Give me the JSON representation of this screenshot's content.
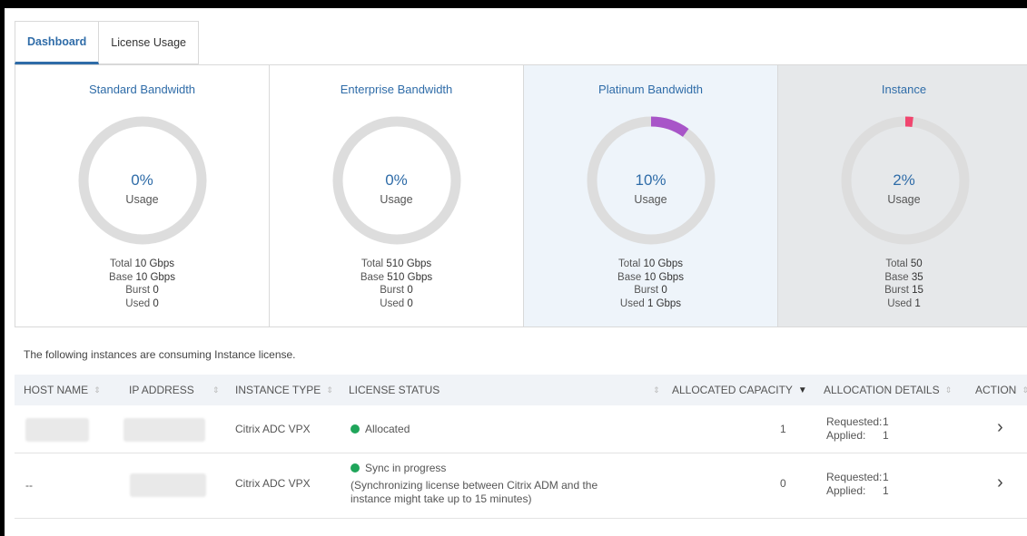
{
  "tabs": [
    {
      "label": "Dashboard",
      "active": true
    },
    {
      "label": "License Usage",
      "active": false
    }
  ],
  "cards": [
    {
      "title": "Standard Bandwidth",
      "percent_label": "0%",
      "usage_label": "Usage",
      "usage_fraction": 0.0,
      "stats": {
        "total_label": "Total",
        "total": "10 Gbps",
        "base_label": "Base",
        "base": "10 Gbps",
        "burst_label": "Burst",
        "burst": "0",
        "used_label": "Used",
        "used": "0"
      }
    },
    {
      "title": "Enterprise Bandwidth",
      "percent_label": "0%",
      "usage_label": "Usage",
      "usage_fraction": 0.0,
      "stats": {
        "total_label": "Total",
        "total": "510 Gbps",
        "base_label": "Base",
        "base": "510 Gbps",
        "burst_label": "Burst",
        "burst": "0",
        "used_label": "Used",
        "used": "0"
      }
    },
    {
      "title": "Platinum Bandwidth",
      "percent_label": "10%",
      "usage_label": "Usage",
      "usage_fraction": 0.1,
      "stats": {
        "total_label": "Total",
        "total": "10 Gbps",
        "base_label": "Base",
        "base": "10 Gbps",
        "burst_label": "Burst",
        "burst": "0",
        "used_label": "Used",
        "used": "1 Gbps"
      }
    },
    {
      "title": "Instance",
      "percent_label": "2%",
      "usage_label": "Usage",
      "usage_fraction": 0.02,
      "stats": {
        "total_label": "Total",
        "total": "50",
        "base_label": "Base",
        "base": "35",
        "burst_label": "Burst",
        "burst": "15",
        "used_label": "Used",
        "used": "1"
      }
    }
  ],
  "colors": {
    "accent": "#2f6ca8",
    "ring_track": "#dddddd",
    "platinum_arc": "#a855c8",
    "instance_arc": "#f0456e",
    "status_green": "#1fa55a"
  },
  "caption": "The following instances are consuming Instance license.",
  "table": {
    "headers": [
      "HOST NAME",
      "IP ADDRESS",
      "INSTANCE TYPE",
      "LICENSE STATUS",
      "ALLOCATED CAPACITY",
      "ALLOCATION DETAILS",
      "ACTION"
    ],
    "rows": [
      {
        "host_name": "",
        "ip_address": "",
        "instance_type": "Citrix ADC VPX",
        "status": "Allocated",
        "status_note": "",
        "allocated_capacity": "1",
        "requested_label": "Requested:",
        "requested": "1",
        "applied_label": "Applied:",
        "applied": "1",
        "action_icon": "chevron-right-icon"
      },
      {
        "host_name": "--",
        "ip_address": "",
        "instance_type": "Citrix ADC VPX",
        "status": "Sync in progress",
        "status_note_line1": "(Synchronizing license between Citrix ADM and the",
        "status_note_line2": "instance might take up to 15 minutes)",
        "allocated_capacity": "0",
        "requested_label": "Requested:",
        "requested": "1",
        "applied_label": "Applied:",
        "applied": "1",
        "action_icon": "chevron-right-icon"
      }
    ]
  }
}
